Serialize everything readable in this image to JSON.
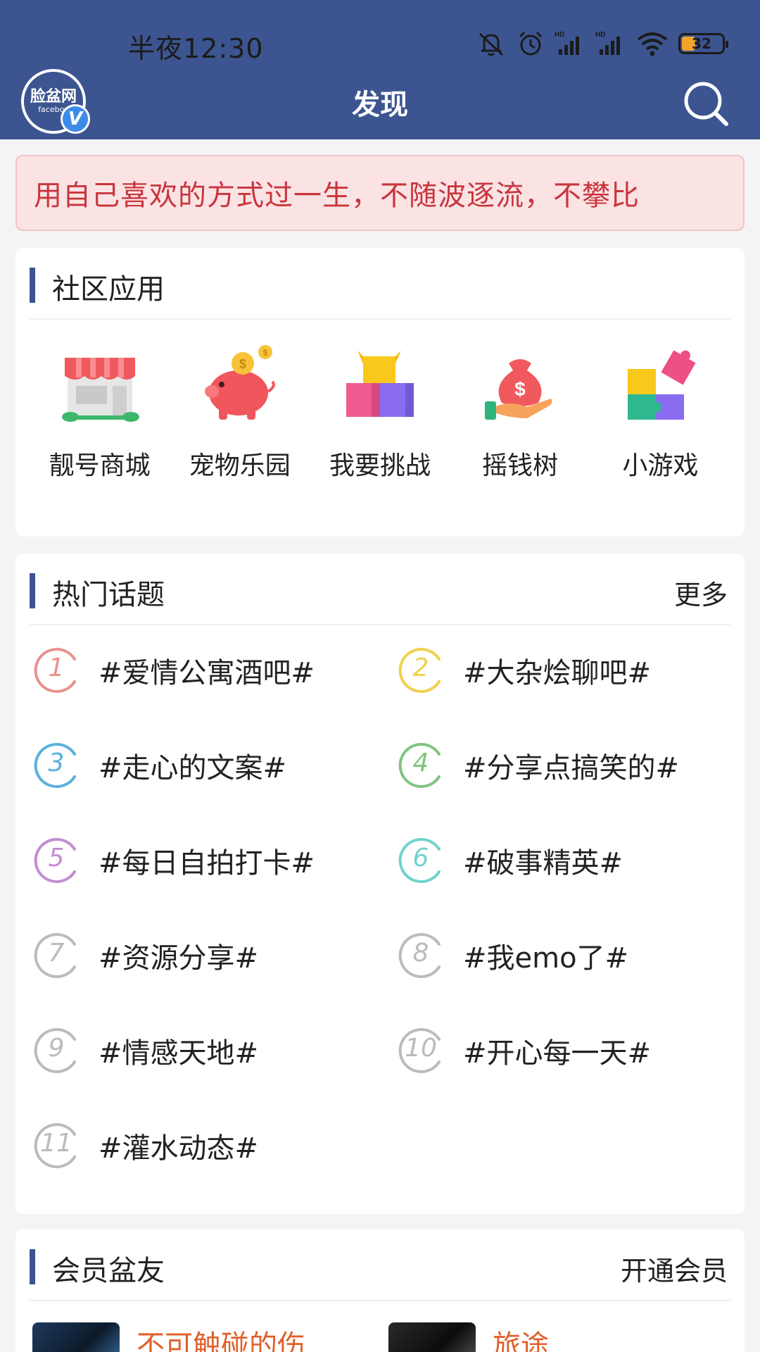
{
  "status_bar": {
    "time": "半夜12:30",
    "battery": "32",
    "battery_level": 0.32
  },
  "header": {
    "logo_text": "脸盆网",
    "logo_subtext": "facebov",
    "logo_badge": "V",
    "title": "发现"
  },
  "notice": {
    "text": "用自己喜欢的方式过一生，不随波逐流，不攀比"
  },
  "community_apps": {
    "title": "社区应用",
    "items": [
      {
        "label": "靓号商城",
        "icon": "store-icon"
      },
      {
        "label": "宠物乐园",
        "icon": "piggy-bank-icon"
      },
      {
        "label": "我要挑战",
        "icon": "boxes-icon"
      },
      {
        "label": "摇钱树",
        "icon": "money-bag-icon"
      },
      {
        "label": "小游戏",
        "icon": "puzzle-icon"
      }
    ]
  },
  "hot_topics": {
    "title": "热门话题",
    "more": "更多",
    "items": [
      {
        "rank": "1",
        "text": "#爱情公寓酒吧#",
        "color": "#e8928f"
      },
      {
        "rank": "2",
        "text": "#大杂烩聊吧#",
        "color": "#f0d14f"
      },
      {
        "rank": "3",
        "text": "#走心的文案#",
        "color": "#5ab0dd"
      },
      {
        "rank": "4",
        "text": "#分享点搞笑的#",
        "color": "#7fc47f"
      },
      {
        "rank": "5",
        "text": "#每日自拍打卡#",
        "color": "#c48cd2"
      },
      {
        "rank": "6",
        "text": "#破事精英#",
        "color": "#6fd3cf"
      },
      {
        "rank": "7",
        "text": "#资源分享#",
        "color": "#bbbbbb"
      },
      {
        "rank": "8",
        "text": "#我emo了#",
        "color": "#bbbbbb"
      },
      {
        "rank": "9",
        "text": "#情感天地#",
        "color": "#bbbbbb"
      },
      {
        "rank": "10",
        "text": "#开心每一天#",
        "color": "#bbbbbb"
      },
      {
        "rank": "11",
        "text": "#灌水动态#",
        "color": "#bbbbbb"
      }
    ]
  },
  "member_friends": {
    "title": "会员盆友",
    "action": "开通会员",
    "members": [
      {
        "name": "不可触碰的伤"
      },
      {
        "name": "旅途"
      }
    ]
  }
}
